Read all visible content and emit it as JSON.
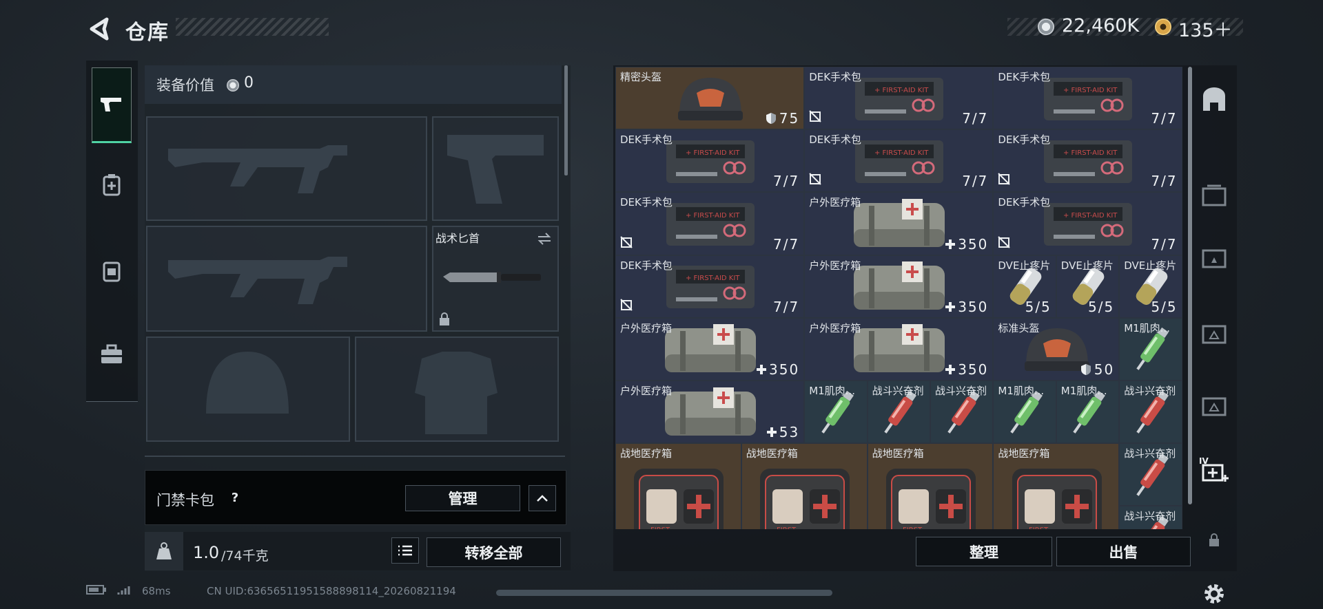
{
  "header": {
    "title": "仓库",
    "currency_silver": "22,460K",
    "currency_gold": "135＋"
  },
  "loadout": {
    "equipment_value_label": "装备价值",
    "equipment_value": "0",
    "knife_label": "战术匕首",
    "keycard_label": "门禁卡包",
    "help_label": "?",
    "manage_button": "管理",
    "weight_current": "1.0",
    "weight_max": "/74千克",
    "transfer_all_button": "转移全部"
  },
  "inventory": {
    "items": [
      {
        "name": "精密头盔",
        "count": "75"
      },
      {
        "name": "DEK手术包",
        "count": "7/7"
      },
      {
        "name": "DEK手术包",
        "count": "7/7"
      },
      {
        "name": "DEK手术包",
        "count": "7/7"
      },
      {
        "name": "DEK手术包",
        "count": "7/7"
      },
      {
        "name": "DEK手术包",
        "count": "7/7"
      },
      {
        "name": "DEK手术包",
        "count": "7/7"
      },
      {
        "name": "户外医疗箱",
        "count": "350"
      },
      {
        "name": "DEK手术包",
        "count": "7/7"
      },
      {
        "name": "DEK手术包",
        "count": "7/7"
      },
      {
        "name": "户外医疗箱",
        "count": "350"
      },
      {
        "name": "DVE止疼片",
        "count": "5/5"
      },
      {
        "name": "DVE止疼片",
        "count": "5/5"
      },
      {
        "name": "DVE止疼片",
        "count": "5/5"
      },
      {
        "name": "户外医疗箱",
        "count": "350"
      },
      {
        "name": "户外医疗箱",
        "count": "350"
      },
      {
        "name": "标准头盔",
        "count": "50"
      },
      {
        "name": "M1肌肉...",
        "count": ""
      },
      {
        "name": "户外医疗箱",
        "count": "53"
      },
      {
        "name": "M1肌肉...",
        "count": ""
      },
      {
        "name": "战斗兴奋剂",
        "count": ""
      },
      {
        "name": "战斗兴奋剂",
        "count": ""
      },
      {
        "name": "M1肌肉...",
        "count": ""
      },
      {
        "name": "M1肌肉...",
        "count": ""
      },
      {
        "name": "战斗兴奋剂",
        "count": ""
      },
      {
        "name": "战地医疗箱",
        "count": ""
      },
      {
        "name": "战地医疗箱",
        "count": ""
      },
      {
        "name": "战地医疗箱",
        "count": ""
      },
      {
        "name": "战地医疗箱",
        "count": ""
      },
      {
        "name": "战斗兴奋剂",
        "count": ""
      },
      {
        "name": "战斗兴奋剂",
        "count": ""
      }
    ],
    "organize_button": "整理",
    "sell_button": "出售"
  },
  "status": {
    "ping": "68ms",
    "uid": "CN UID:6365651195158889811​4_20260821194"
  },
  "colors": {
    "accent": "#4fd3a4",
    "cell_blue": "#2c3348",
    "cell_gold": "#4c3e2f",
    "cell_teal": "#2a3a45"
  }
}
